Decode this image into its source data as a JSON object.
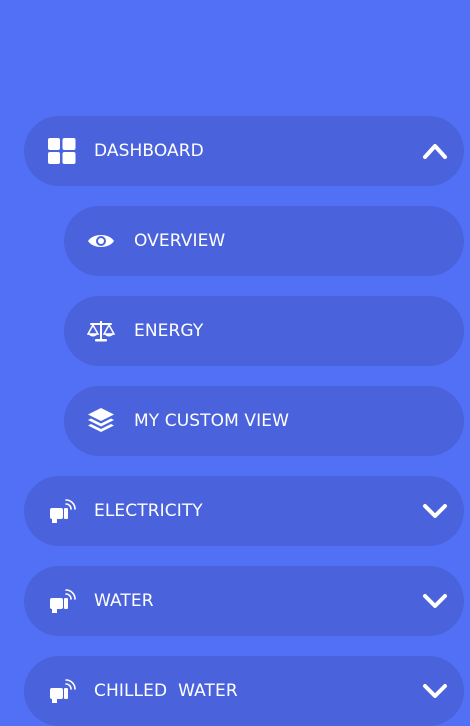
{
  "menu": {
    "dashboard": {
      "label": "DASHBOARD",
      "icon": "dashboard-grid-icon",
      "state": "expanded"
    },
    "overview": {
      "label": "OVERVIEW",
      "icon": "eye-icon"
    },
    "energy": {
      "label": "ENERGY",
      "icon": "balance-scale-icon"
    },
    "custom_view": {
      "label": "MY CUSTOM VIEW",
      "icon": "layers-icon"
    },
    "electricity": {
      "label": "ELECTRICITY",
      "icon": "sensor-icon",
      "state": "collapsed"
    },
    "water": {
      "label": "WATER",
      "icon": "sensor-icon",
      "state": "collapsed"
    },
    "chilled_water": {
      "label": "CHILLED  WATER",
      "icon": "sensor-icon",
      "state": "collapsed"
    }
  },
  "colors": {
    "background": "#5170f5",
    "item_background": "#4a63dc",
    "text": "#ffffff"
  }
}
